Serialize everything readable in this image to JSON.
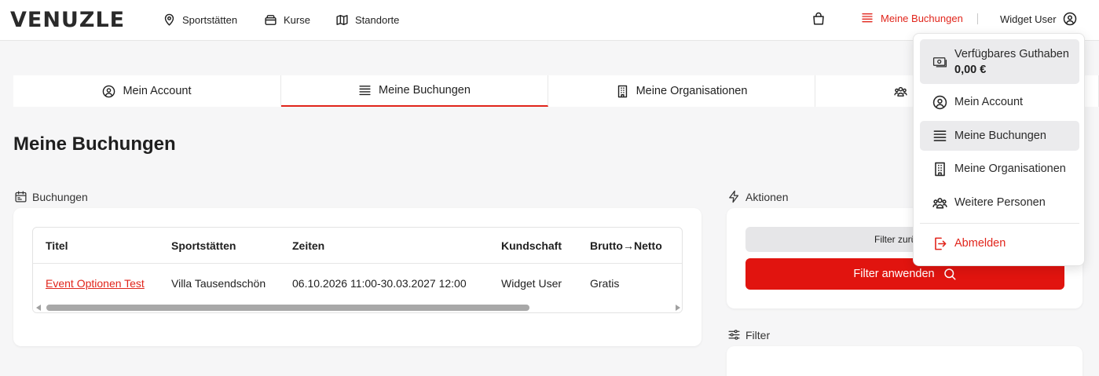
{
  "brand": {
    "logo_text": "VENUZLE",
    "accent_color": "#e1251b"
  },
  "header": {
    "nav": [
      {
        "label": "Sportstätten",
        "icon": "map-pin-icon"
      },
      {
        "label": "Kurse",
        "icon": "card-stack-icon"
      },
      {
        "label": "Standorte",
        "icon": "map-icon"
      }
    ],
    "cart_icon": "shopping-bag-icon",
    "bookings_label": "Meine Buchungen",
    "user_label": "Widget User"
  },
  "tabs": [
    {
      "label": "Mein Account",
      "icon": "user-circle-icon"
    },
    {
      "label": "Meine Buchungen",
      "icon": "list-icon",
      "active": true
    },
    {
      "label": "Meine Organisationen",
      "icon": "building-icon"
    },
    {
      "label": "",
      "icon": "users-icon"
    }
  ],
  "page": {
    "title": "Meine Buchungen"
  },
  "bookings": {
    "section_label": "Buchungen",
    "columns": [
      "Titel",
      "Sportstätten",
      "Zeiten",
      "Kundschaft",
      "Brutto→Netto"
    ],
    "rows": [
      {
        "title": "Event Optionen Test",
        "venue": "Villa Tausendschön",
        "times": "06.10.2026 11:00-30.03.2027 12:00",
        "customer": "Widget User",
        "price": "Gratis"
      }
    ]
  },
  "actions": {
    "section_label": "Aktionen",
    "reset_label": "Filter zurückse",
    "apply_label": "Filter anwenden"
  },
  "filter": {
    "section_label": "Filter"
  },
  "dropdown": {
    "balance_label": "Verfügbares Guthaben",
    "balance_value": "0,00 €",
    "items": [
      {
        "label": "Mein Account",
        "icon": "user-circle-icon"
      },
      {
        "label": "Meine Buchungen",
        "icon": "list-icon",
        "highlighted": true
      },
      {
        "label": "Meine Organisationen",
        "icon": "building-icon"
      },
      {
        "label": "Weitere Personen",
        "icon": "users-icon"
      }
    ],
    "logout_label": "Abmelden"
  }
}
